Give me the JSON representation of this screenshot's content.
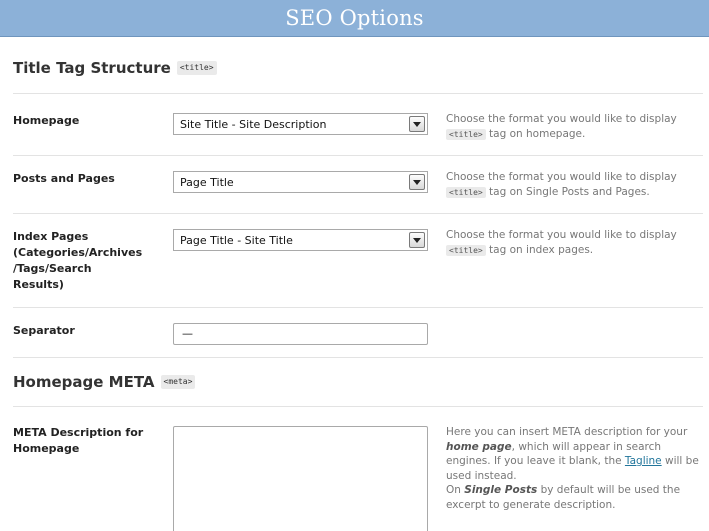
{
  "header": {
    "title": "SEO Options"
  },
  "title_section": {
    "heading": "Title Tag Structure",
    "tag": "<title>"
  },
  "homepage": {
    "label": "Homepage",
    "selected": "Site Title - Site Description",
    "help_before": "Choose the format you would like to display ",
    "help_tag": "<title>",
    "help_after": " tag on homepage."
  },
  "posts_pages": {
    "label": "Posts and Pages",
    "selected": "Page Title",
    "help_before": "Choose the format you would like to display ",
    "help_tag": "<title>",
    "help_after": " tag on Single Posts and Pages."
  },
  "index_pages": {
    "label_line1": "Index Pages",
    "label_line2": "(Categories/Archives",
    "label_line3": "/Tags/Search",
    "label_line4": "Results)",
    "selected": "Page Title - Site Title",
    "help_before": "Choose the format you would like to display ",
    "help_tag": "<title>",
    "help_after": " tag on index pages."
  },
  "separator": {
    "label": "Separator",
    "value": "—"
  },
  "meta_section": {
    "heading": "Homepage META",
    "tag": "<meta>"
  },
  "meta_description": {
    "label_line1": "META Description for",
    "label_line2": "Homepage",
    "value": "",
    "help_1": "Here you can insert META description for your ",
    "help_home_page": "home page",
    "help_2": ", which will appear in search engines. If you leave it blank, the ",
    "help_tagline": "Tagline",
    "help_3": " will be used instead.",
    "help_4": "On ",
    "help_single_posts": "Single Posts",
    "help_5": " by default will be used the excerpt to generate description."
  }
}
